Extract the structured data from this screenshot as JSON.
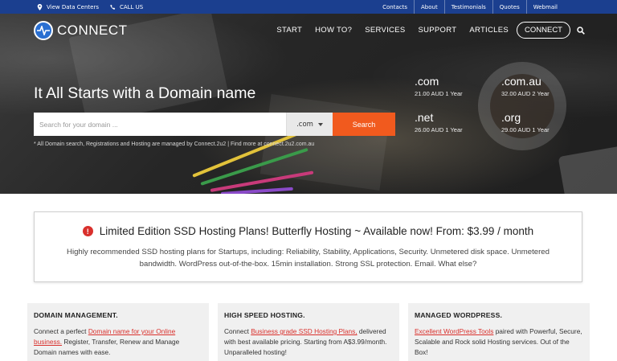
{
  "topbar": {
    "view_data_centers": "View Data Centers",
    "call_us": "CALL US",
    "links": [
      "Contacts",
      "About",
      "Testimonials",
      "Quotes",
      "Webmail"
    ]
  },
  "header": {
    "brand": "CONNECT",
    "nav": [
      "START",
      "HOW TO?",
      "SERVICES",
      "SUPPORT",
      "ARTICLES"
    ],
    "cta": "CONNECT",
    "search_icon": "search-icon"
  },
  "hero": {
    "title": "It All Starts with a Domain name",
    "search_placeholder": "Search for your domain ...",
    "tld_selected": ".com",
    "search_button": "Search",
    "disclaimer": "* All Domain search, Registrations and Hosting are managed by Connect.2u2 | Find more at connect.2u2.com.au",
    "prices": [
      {
        "tld": ".com",
        "price": "21.00 AUD 1 Year"
      },
      {
        "tld": ".com.au",
        "price": "32.00 AUD 2 Year"
      },
      {
        "tld": ".net",
        "price": "26.00 AUD 1 Year"
      },
      {
        "tld": ".org",
        "price": "29.00 AUD 1 Year"
      }
    ]
  },
  "announcement": {
    "title": "Limited Edition SSD Hosting Plans! Butterfly Hosting ~ Available now! From: $3.99 / month",
    "body": "Highly recommended SSD hosting plans for Startups, including: Reliability, Stability, Applications, Security. Unmetered disk space. Unmetered bandwidth. WordPress out-of-the-box. 15min installation. Strong SSL protection. Email. What else?"
  },
  "cards": [
    {
      "heading": "DOMAIN MANAGEMENT.",
      "pre": "Connect a perfect ",
      "link": "Domain name for your Online business.",
      "post": " Register, Transfer, Renew and Manage Domain names with ease."
    },
    {
      "heading": "HIGH SPEED HOSTING.",
      "pre": "Connect ",
      "link": "Business grade SSD Hosting Plans,",
      "post": " delivered with best available pricing. Starting from A$3.99/month. Unparalleled hosting!"
    },
    {
      "heading": "MANAGED WORDPRESS.",
      "pre": "",
      "link": "Excellent WordPress Tools",
      "post": " paired with Powerful, Secure, Scalable and Rock solid Hosting services. Out of the Box!"
    }
  ],
  "colors": {
    "topbar": "#1b3f8f",
    "accent_orange": "#f15a1e",
    "link_red": "#d9302c",
    "brand_blue": "#2a6fd1"
  }
}
